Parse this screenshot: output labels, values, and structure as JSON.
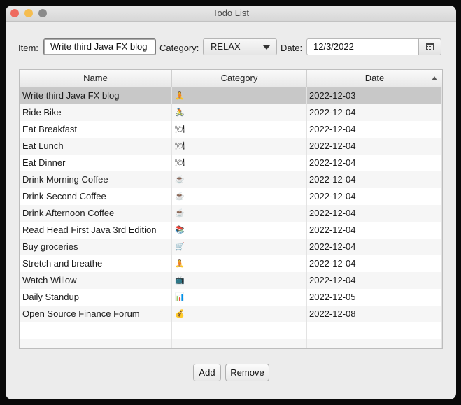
{
  "window": {
    "title": "Todo List"
  },
  "form": {
    "item_label": "Item:",
    "item_value": "Write third Java FX blog",
    "category_label": "Category:",
    "category_value": "RELAX",
    "date_label": "Date:",
    "date_value": "12/3/2022"
  },
  "table": {
    "columns": [
      "Name",
      "Category",
      "Date"
    ],
    "sorted_column": "Date",
    "rows": [
      {
        "name": "Write third Java FX blog",
        "icon": "relax-icon",
        "glyph": "🧘",
        "date": "2022-12-03"
      },
      {
        "name": "Ride Bike",
        "icon": "bike-icon",
        "glyph": "🚴",
        "date": "2022-12-04"
      },
      {
        "name": "Eat Breakfast",
        "icon": "food-icon",
        "glyph": "🍽",
        "date": "2022-12-04"
      },
      {
        "name": "Eat Lunch",
        "icon": "food-icon",
        "glyph": "🍽",
        "date": "2022-12-04"
      },
      {
        "name": "Eat Dinner",
        "icon": "food-icon",
        "glyph": "🍽",
        "date": "2022-12-04"
      },
      {
        "name": "Drink Morning Coffee",
        "icon": "coffee-icon",
        "glyph": "☕",
        "date": "2022-12-04"
      },
      {
        "name": "Drink Second Coffee",
        "icon": "coffee-icon",
        "glyph": "☕",
        "date": "2022-12-04"
      },
      {
        "name": "Drink Afternoon Coffee",
        "icon": "coffee-icon",
        "glyph": "☕",
        "date": "2022-12-04"
      },
      {
        "name": "Read Head First Java 3rd Edition",
        "icon": "books-icon",
        "glyph": "📚",
        "date": "2022-12-04"
      },
      {
        "name": "Buy groceries",
        "icon": "cart-icon",
        "glyph": "🛒",
        "date": "2022-12-04"
      },
      {
        "name": "Stretch and breathe",
        "icon": "relax-icon",
        "glyph": "🧘",
        "date": "2022-12-04"
      },
      {
        "name": "Watch Willow",
        "icon": "tv-icon",
        "glyph": "📺",
        "date": "2022-12-04"
      },
      {
        "name": "Daily Standup",
        "icon": "chart-icon",
        "glyph": "📊",
        "date": "2022-12-05"
      },
      {
        "name": "Open Source Finance Forum",
        "icon": "finance-icon",
        "glyph": "💰",
        "date": "2022-12-08"
      }
    ]
  },
  "buttons": {
    "add": "Add",
    "remove": "Remove"
  },
  "colors": {
    "selected_row": "#c8c8c8",
    "window_bg": "#ececec"
  }
}
